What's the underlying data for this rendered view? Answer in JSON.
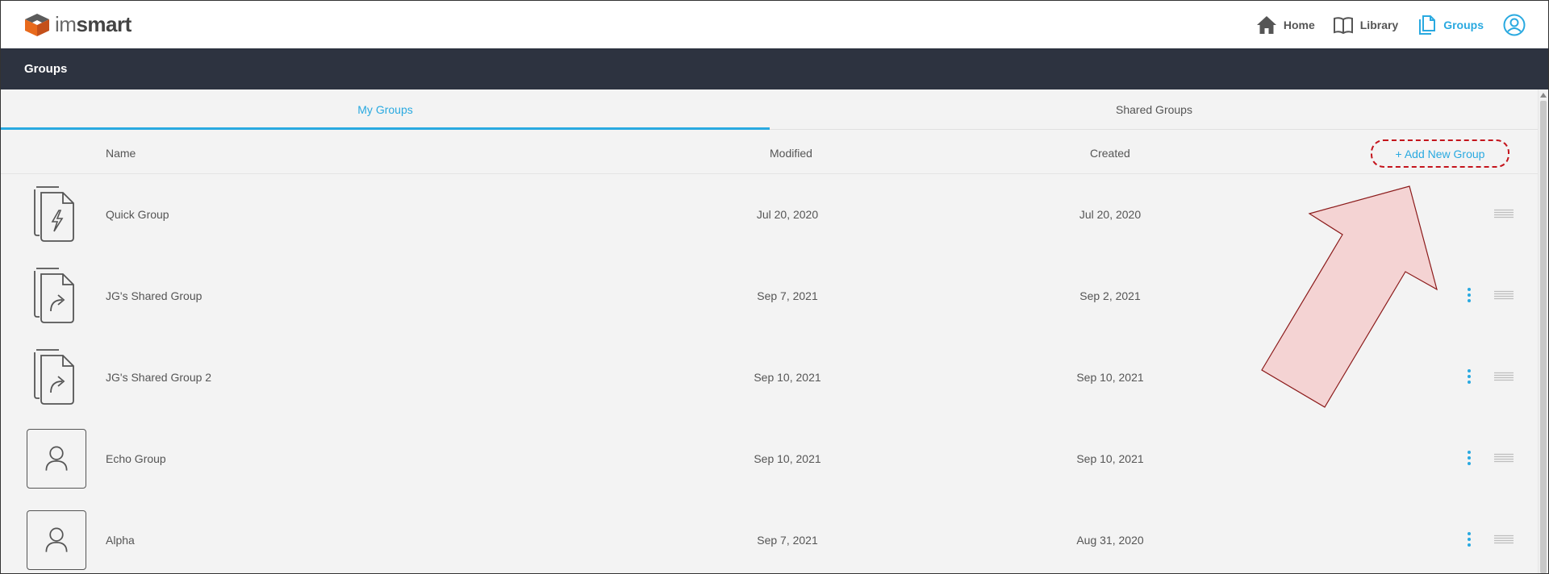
{
  "brand": {
    "light": "im",
    "bold": "smart"
  },
  "nav": {
    "home": "Home",
    "library": "Library",
    "groups": "Groups"
  },
  "page": {
    "title": "Groups"
  },
  "tabs": [
    {
      "label": "My Groups",
      "active": true
    },
    {
      "label": "Shared Groups",
      "active": false
    }
  ],
  "columns": {
    "name": "Name",
    "modified": "Modified",
    "created": "Created"
  },
  "add_button": "+ Add New Group",
  "rows": [
    {
      "name": "Quick Group",
      "modified": "Jul 20, 2020",
      "created": "Jul 20, 2020",
      "icon": "quick-group-icon",
      "menu": false
    },
    {
      "name": "JG's Shared Group",
      "modified": "Sep 7, 2021",
      "created": "Sep 2, 2021",
      "icon": "shared-group-icon",
      "menu": true
    },
    {
      "name": "JG's Shared Group 2",
      "modified": "Sep 10, 2021",
      "created": "Sep 10, 2021",
      "icon": "shared-group-icon",
      "menu": true
    },
    {
      "name": "Echo Group",
      "modified": "Sep 10, 2021",
      "created": "Sep 10, 2021",
      "icon": "person-icon",
      "menu": true
    },
    {
      "name": "Alpha",
      "modified": "Sep 7, 2021",
      "created": "Aug 31, 2020",
      "icon": "person-icon",
      "menu": true
    }
  ],
  "colors": {
    "accent": "#29a9e0",
    "header_bg": "#2d3340",
    "annotation_red": "#c4141c",
    "arrow_fill": "#f4d3d3",
    "arrow_stroke": "#8b1a1a"
  }
}
